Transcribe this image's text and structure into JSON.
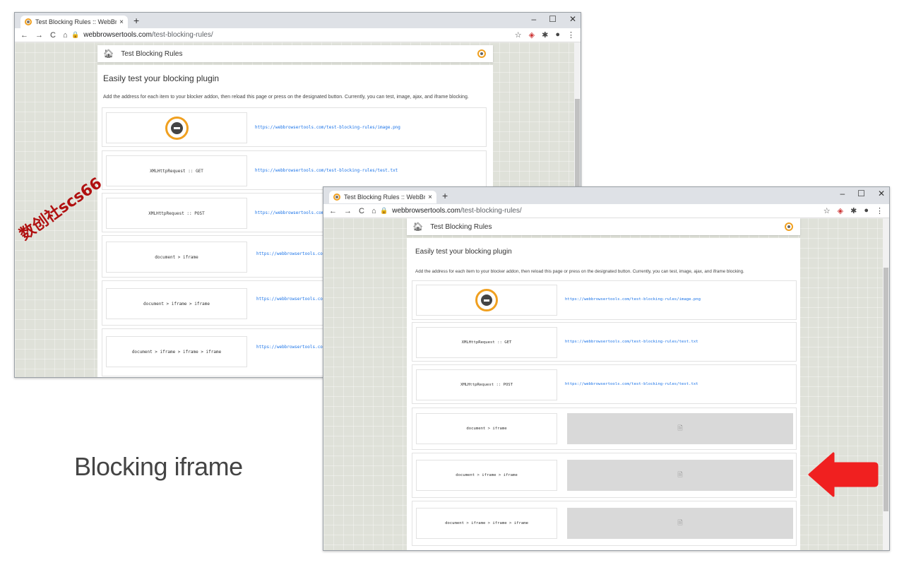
{
  "browser": {
    "tab_title": "Test Blocking Rules :: WebBrows",
    "tab_close": "×",
    "new_tab": "+",
    "win_min": "–",
    "win_max": "☐",
    "win_close": "✕",
    "nav_back": "←",
    "nav_forward": "→",
    "nav_reload": "C",
    "nav_home": "⌂",
    "lock": "🔒",
    "url_domain": "webbrowsertools.com",
    "url_path": "/test-blocking-rules/",
    "star": "☆",
    "menu": "⋮"
  },
  "site": {
    "bar_title": "Test Blocking Rules",
    "heading": "Easily test your blocking plugin",
    "description": "Add the address for each item to your blocker addon, then reload this page or press on the designated button. Currently, you can test, image, ajax, and iframe blocking."
  },
  "rows_back": [
    {
      "label": "",
      "link": "https://webbrowsertools.com/test-blocking-rules/image.png",
      "kind": "image"
    },
    {
      "label": "XMLHttpRequest :: GET",
      "link": "https://webbrowsertools.com/test-blocking-rules/test.txt"
    },
    {
      "label": "XMLHttpRequest :: POST",
      "link": "https://webbrowsertools.com/"
    },
    {
      "label": "document > iframe",
      "link": "https://webbrowsertools.com"
    },
    {
      "label": "document > iframe > iframe",
      "link": "https://webbrowsertools.com"
    },
    {
      "label": "document > iframe > iframe > iframe",
      "link": "https://webbrowsertools.com"
    }
  ],
  "rows_front": [
    {
      "label": "",
      "link": "https://webbrowsertools.com/test-blocking-rules/image.png",
      "kind": "image"
    },
    {
      "label": "XMLHttpRequest :: GET",
      "link": "https://webbrowsertools.com/test-blocking-rules/test.txt"
    },
    {
      "label": "XMLHttpRequest :: POST",
      "link": "https://webbrowsertools.com/test-blocking-rules/test.txt"
    },
    {
      "label": "document > iframe",
      "blocked_icon": "🗎"
    },
    {
      "label": "document > iframe > iframe",
      "blocked_icon": "🗎"
    },
    {
      "label": "document > iframe > iframe > iframe",
      "blocked_icon": "🗎"
    }
  ],
  "caption": "Blocking iframe",
  "watermark": "数创社scs66",
  "colors": {
    "accent": "#f0a020",
    "link": "#1a73e8",
    "arrow": "#f02020"
  }
}
